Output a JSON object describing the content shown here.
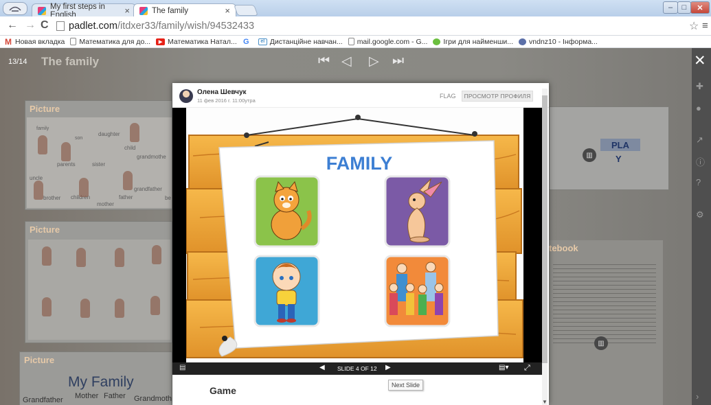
{
  "browser": {
    "tabs": [
      {
        "title": "My first steps in English",
        "active": false
      },
      {
        "title": "The family",
        "active": true
      }
    ],
    "url_host": "padlet.com",
    "url_path": "/itdxer33/family/wish/94532433",
    "bookmarks": [
      {
        "label": "Новая вкладка",
        "icon": "gmail-icon",
        "color": "#d44638"
      },
      {
        "label": "Математика для до...",
        "icon": "page-icon",
        "color": "#ffffff"
      },
      {
        "label": "Математика Натал...",
        "icon": "youtube-icon",
        "color": "#e62117"
      },
      {
        "label": "",
        "icon": "google-icon",
        "color": "#ffffff"
      },
      {
        "label": "Дистанційне навчан...",
        "icon": "site-icon",
        "color": "#4a90c8"
      },
      {
        "label": "mail.google.com - G...",
        "icon": "page-icon",
        "color": "#ffffff"
      },
      {
        "label": "Ігри для найменши...",
        "icon": "games-icon",
        "color": "#6bbf3f"
      },
      {
        "label": "vndnz10 - Інформа...",
        "icon": "chrome-icon",
        "color": "#5b6fa8"
      }
    ]
  },
  "padlet": {
    "counter": "13/14",
    "title": "The family",
    "bg_cards": [
      {
        "title": "Picture"
      },
      {
        "title": "Picture"
      },
      {
        "title": "Picture"
      },
      {
        "title": "tebook"
      }
    ],
    "bg_words": {
      "family": "family",
      "son": "son",
      "daughter": "daughter",
      "child": "child",
      "grandmother": "grandmothe",
      "parents": "parents",
      "sister": "sister",
      "uncle": "uncle",
      "brother": "brother",
      "children": "children",
      "mother": "mother",
      "father": "father",
      "grandfather": "grandfather",
      "be": "be",
      "my_family": "My Family",
      "grandfather2": "Grandfather",
      "mother2": "Mother",
      "father2": "Father",
      "grandmoth": "Grandmoth",
      "pla": "PLA",
      "y": "Y"
    }
  },
  "post": {
    "author": "Олена Шевчук",
    "posted": "11 фев 2016 г. 11:00утра",
    "flag_label": "FLAG",
    "profile_label": "ПРОСМОТР ПРОФИЛЯ",
    "slide_title": "FAMILY",
    "slide_counter": "SLIDE 4 OF 12",
    "tooltip": "Next Slide",
    "title": "Game"
  },
  "colors": {
    "accent": "#2f7fd0",
    "card_green": "#8bc34a",
    "card_purple": "#7b5aa6",
    "card_blue": "#3fa7d6",
    "card_orange": "#f28a3a",
    "wood": "#f2a531"
  }
}
